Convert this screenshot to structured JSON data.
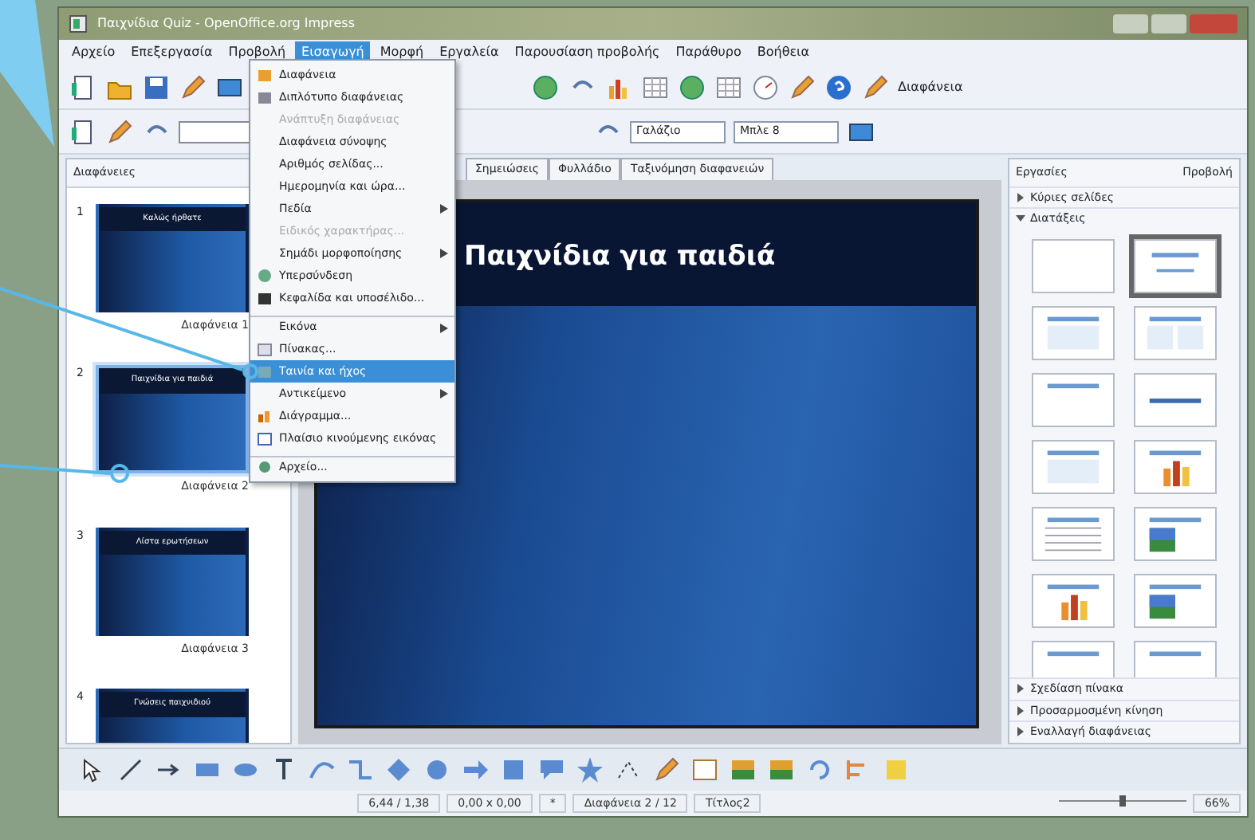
{
  "window": {
    "title": "Παιχνίδια Quiz - OpenOffice.org Impress"
  },
  "menubar": [
    {
      "label": "Αρχείο",
      "selected": false
    },
    {
      "label": "Επεξεργασία",
      "selected": false
    },
    {
      "label": "Προβολή",
      "selected": false
    },
    {
      "label": "Εισαγωγή",
      "selected": true
    },
    {
      "label": "Μορφή",
      "selected": false
    },
    {
      "label": "Εργαλεία",
      "selected": false
    },
    {
      "label": "Παρουσίαση προβολής",
      "selected": false
    },
    {
      "label": "Παράθυρο",
      "selected": false
    },
    {
      "label": "Βοήθεια",
      "selected": false
    }
  ],
  "toolbar": {
    "extra_label": "Διαφάνεια",
    "area_style": "Γαλάζιο",
    "fill_color": "Μπλε 8"
  },
  "menu": [
    {
      "label": "Διαφάνεια",
      "disabled": false,
      "submenu": false,
      "selected": false,
      "separator_before": false
    },
    {
      "label": "Διπλότυπο διαφάνειας",
      "disabled": false,
      "submenu": false,
      "selected": false,
      "separator_before": false
    },
    {
      "label": "Ανάπτυξη διαφάνειας",
      "disabled": true,
      "submenu": false,
      "selected": false,
      "separator_before": false
    },
    {
      "label": "Διαφάνεια σύνοψης",
      "disabled": false,
      "submenu": false,
      "selected": false,
      "separator_before": false
    },
    {
      "label": "Αριθμός σελίδας...",
      "disabled": false,
      "submenu": false,
      "selected": false,
      "separator_before": false
    },
    {
      "label": "Ημερομηνία και ώρα...",
      "disabled": false,
      "submenu": false,
      "selected": false,
      "separator_before": false
    },
    {
      "label": "Πεδία",
      "disabled": false,
      "submenu": true,
      "selected": false,
      "separator_before": false
    },
    {
      "label": "Ειδικός χαρακτήρας...",
      "disabled": true,
      "submenu": false,
      "selected": false,
      "separator_before": false
    },
    {
      "label": "Σημάδι μορφοποίησης",
      "disabled": false,
      "submenu": true,
      "selected": false,
      "separator_before": false
    },
    {
      "label": "Υπερσύνδεση",
      "disabled": false,
      "submenu": false,
      "selected": false,
      "separator_before": false
    },
    {
      "label": "Κεφαλίδα και υποσέλιδο...",
      "disabled": false,
      "submenu": false,
      "selected": false,
      "separator_before": false
    },
    {
      "label": "Εικόνα",
      "disabled": false,
      "submenu": true,
      "selected": false,
      "separator_before": true
    },
    {
      "label": "Πίνακας...",
      "disabled": false,
      "submenu": false,
      "selected": false,
      "separator_before": false
    },
    {
      "label": "Ταινία και ήχος",
      "disabled": false,
      "submenu": false,
      "selected": true,
      "separator_before": false
    },
    {
      "label": "Αντικείμενο",
      "disabled": false,
      "submenu": true,
      "selected": false,
      "separator_before": false
    },
    {
      "label": "Διάγραμμα...",
      "disabled": false,
      "submenu": false,
      "selected": false,
      "separator_before": false
    },
    {
      "label": "Πλαίσιο κινούμενης εικόνας",
      "disabled": false,
      "submenu": false,
      "selected": false,
      "separator_before": false
    },
    {
      "label": "Αρχείο...",
      "disabled": false,
      "submenu": false,
      "selected": false,
      "separator_before": true
    }
  ],
  "slides_pane": {
    "title": "Διαφάνειες",
    "slides": [
      {
        "number": "1",
        "title": "Καλώς ήρθατε",
        "caption": "Διαφάνεια 1",
        "selected": false
      },
      {
        "number": "2",
        "title": "Παιχνίδια για παιδιά",
        "caption": "Διαφάνεια 2",
        "selected": true
      },
      {
        "number": "3",
        "title": "Λίστα ερωτήσεων",
        "caption": "Διαφάνεια 3",
        "selected": false
      },
      {
        "number": "4",
        "title": "Γνώσεις παιχνιδιού",
        "selected": false
      }
    ]
  },
  "view_tabs": [
    {
      "label": "Σημειώσεις",
      "selected": false
    },
    {
      "label": "Φυλλάδιο",
      "selected": false
    },
    {
      "label": "Ταξινόμηση διαφανειών",
      "selected": false
    }
  ],
  "slide": {
    "title": "Παιχνίδια για παιδιά"
  },
  "tasks": {
    "title": "Εργασίες",
    "view_menu": "Προβολή",
    "sections_top": [
      {
        "label": "Κύριες σελίδες",
        "expanded": false
      },
      {
        "label": "Διατάξεις",
        "expanded": true
      }
    ],
    "sections_bottom": [
      {
        "label": "Σχεδίαση πίνακα",
        "expanded": false
      },
      {
        "label": "Προσαρμοσμένη κίνηση",
        "expanded": false
      },
      {
        "label": "Εναλλαγή διαφάνειας",
        "expanded": false
      }
    ],
    "layouts": [
      {
        "kind": "blank",
        "selected": false
      },
      {
        "kind": "title",
        "selected": true
      },
      {
        "kind": "content",
        "selected": false
      },
      {
        "kind": "two",
        "selected": false
      },
      {
        "kind": "titleonly",
        "selected": false
      },
      {
        "kind": "centered",
        "selected": false
      },
      {
        "kind": "content",
        "selected": false
      },
      {
        "kind": "chart",
        "selected": false
      },
      {
        "kind": "table",
        "selected": false
      },
      {
        "kind": "image",
        "selected": false
      },
      {
        "kind": "chart",
        "selected": false
      },
      {
        "kind": "image",
        "selected": false
      },
      {
        "kind": "titleonly",
        "selected": false
      },
      {
        "kind": "titleonly",
        "selected": false
      }
    ]
  },
  "status_bar": {
    "position": "6,44 / 1,38",
    "size": "0,00 x 0,00",
    "modified": "*",
    "slide": "Διαφάνεια 2 / 12",
    "layout": "Τίτλος2",
    "zoom": "66%",
    "zoom_slider": {
      "level": 0.5
    }
  }
}
